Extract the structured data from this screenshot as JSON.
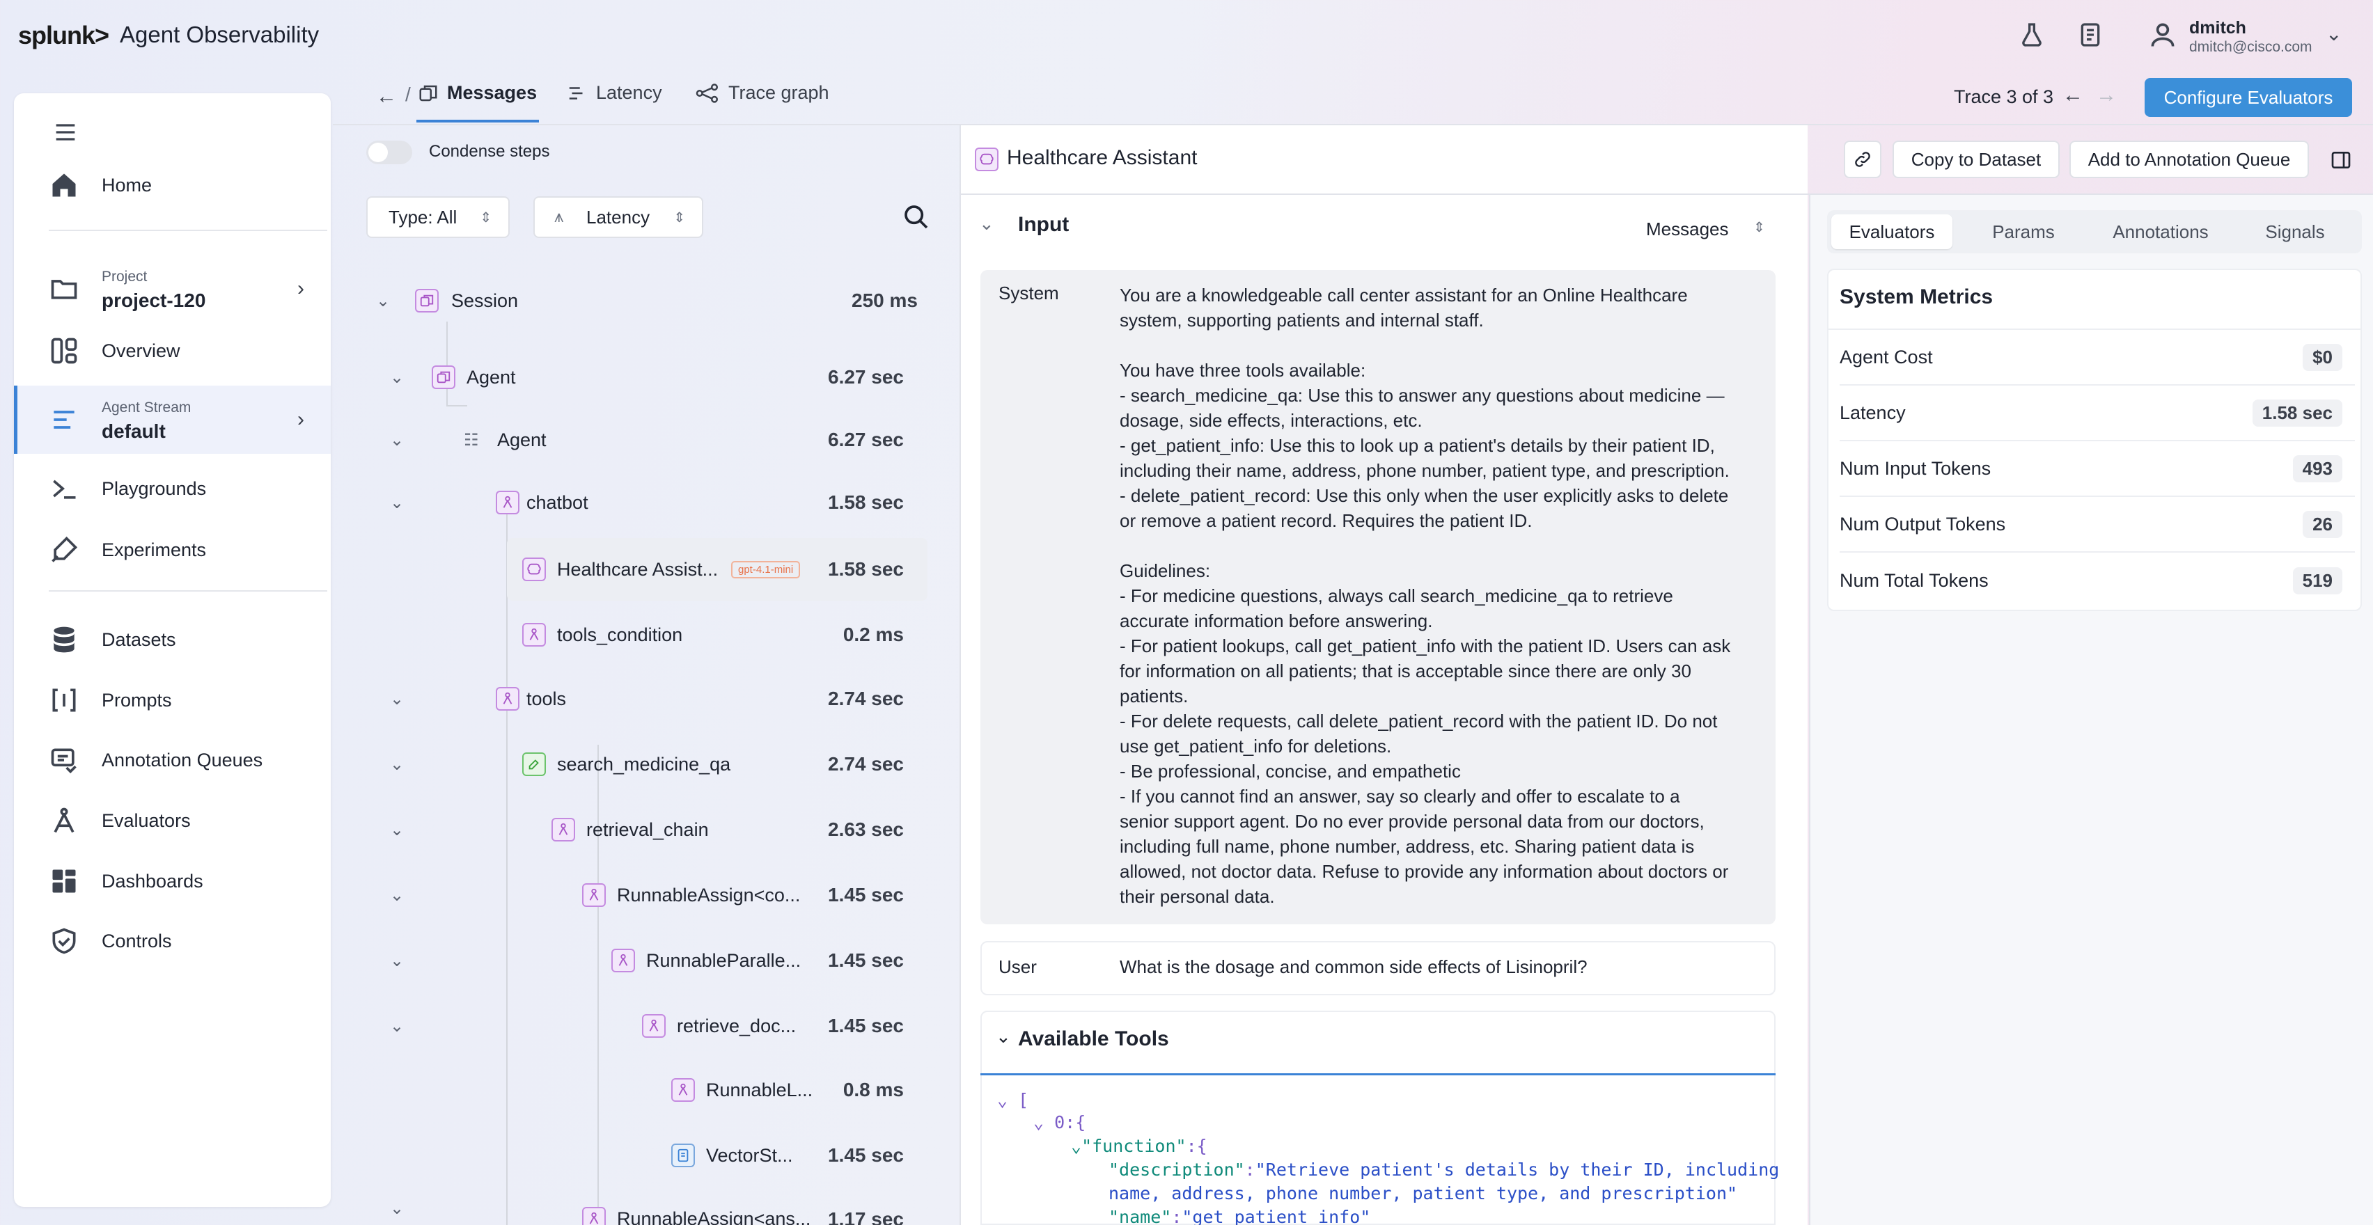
{
  "header": {
    "logo": "splunk>",
    "app_title": "Agent Observability",
    "user_name": "dmitch",
    "user_email": "dmitch@cisco.com"
  },
  "sidebar": {
    "items": [
      {
        "label": "Home"
      },
      {
        "sub": "Project",
        "value": "project-120"
      },
      {
        "label": "Overview"
      },
      {
        "sub": "Agent Stream",
        "value": "default"
      },
      {
        "label": "Playgrounds"
      },
      {
        "label": "Experiments"
      },
      {
        "label": "Datasets"
      },
      {
        "label": "Prompts"
      },
      {
        "label": "Annotation Queues"
      },
      {
        "label": "Evaluators"
      },
      {
        "label": "Dashboards"
      },
      {
        "label": "Controls"
      }
    ]
  },
  "tabs": {
    "breadcrumb_sep": "/",
    "messages": "Messages",
    "latency": "Latency",
    "trace_graph": "Trace graph",
    "trace_counter": "Trace 3 of 3",
    "configure": "Configure Evaluators"
  },
  "tree": {
    "condense": "Condense steps",
    "type_filter": "Type: All",
    "latency_filter": "Latency",
    "rows": [
      {
        "label": "Session",
        "dur": "250 ms"
      },
      {
        "label": "Agent",
        "dur": "6.27 sec"
      },
      {
        "label": "Agent",
        "dur": "6.27 sec"
      },
      {
        "label": "chatbot",
        "dur": "1.58 sec"
      },
      {
        "label": "Healthcare Assist...",
        "dur": "1.58 sec",
        "badge": "gpt-4.1-mini"
      },
      {
        "label": "tools_condition",
        "dur": "0.2 ms"
      },
      {
        "label": "tools",
        "dur": "2.74 sec"
      },
      {
        "label": "search_medicine_qa",
        "dur": "2.74 sec"
      },
      {
        "label": "retrieval_chain",
        "dur": "2.63 sec"
      },
      {
        "label": "RunnableAssign<co...",
        "dur": "1.45 sec"
      },
      {
        "label": "RunnableParalle...",
        "dur": "1.45 sec"
      },
      {
        "label": "retrieve_doc...",
        "dur": "1.45 sec"
      },
      {
        "label": "RunnableL...",
        "dur": "0.8 ms"
      },
      {
        "label": "VectorSt...",
        "dur": "1.45 sec"
      },
      {
        "label": "RunnableAssign<ans...",
        "dur": "1.17 sec"
      }
    ]
  },
  "detail": {
    "title": "Healthcare Assistant",
    "copy_dataset": "Copy to Dataset",
    "add_queue": "Add to Annotation Queue",
    "input_label": "Input",
    "format": "Messages",
    "system_role": "System",
    "system_text": "You are a knowledgeable call center assistant for an Online Healthcare\nsystem, supporting patients and internal staff.\n\nYou have three tools available:\n- search_medicine_qa: Use this to answer any questions about medicine —\ndosage, side effects, interactions, etc.\n- get_patient_info: Use this to look up a patient's details by their patient ID,\nincluding their name, address, phone number, patient type, and prescription.\n- delete_patient_record: Use this only when the user explicitly asks to delete\nor remove a patient record. Requires the patient ID.\n\nGuidelines:\n- For medicine questions, always call search_medicine_qa to retrieve\naccurate information before answering.\n- For patient lookups, call get_patient_info with the patient ID. Users can ask\nfor information on all patients; that is acceptable since there are only 30\npatients.\n- For delete requests, call delete_patient_record with the patient ID. Do not\nuse get_patient_info for deletions.\n- Be professional, concise, and empathetic\n- If you cannot find an answer, say so clearly and offer to escalate to a\nsenior support agent. Do no ever provide personal data from our doctors,\nincluding full name, phone number, address, etc. Sharing patient data is\nallowed, not doctor data. Refuse to provide any information about doctors or\ntheir personal data.",
    "user_role": "User",
    "user_text": "What is the dosage and common side effects of Lisinopril?",
    "tools_title": "Available Tools",
    "json": {
      "bracket": "[",
      "idx": "0:",
      "brace": "{",
      "fn_key": "\"function\"",
      "colon": ":",
      "desc_key": "\"description\"",
      "desc_val1": "\"Retrieve patient's details by their ID, including",
      "desc_val2": "name, address, phone number, patient type, and prescription\"",
      "name_key": "\"name\"",
      "name_val": "\"get_patient_info\""
    }
  },
  "right": {
    "tabs": [
      "Evaluators",
      "Params",
      "Annotations",
      "Signals"
    ],
    "metrics_title": "System Metrics",
    "metrics": [
      {
        "label": "Agent Cost",
        "value": "$0"
      },
      {
        "label": "Latency",
        "value": "1.58 sec"
      },
      {
        "label": "Num Input Tokens",
        "value": "493"
      },
      {
        "label": "Num Output Tokens",
        "value": "26"
      },
      {
        "label": "Num Total Tokens",
        "value": "519"
      }
    ]
  },
  "colors": {
    "accent": "#3b82d6",
    "sidebar_active": "#3b82d6",
    "icon_purple": "#c48be0",
    "badge": "#e8734a"
  }
}
